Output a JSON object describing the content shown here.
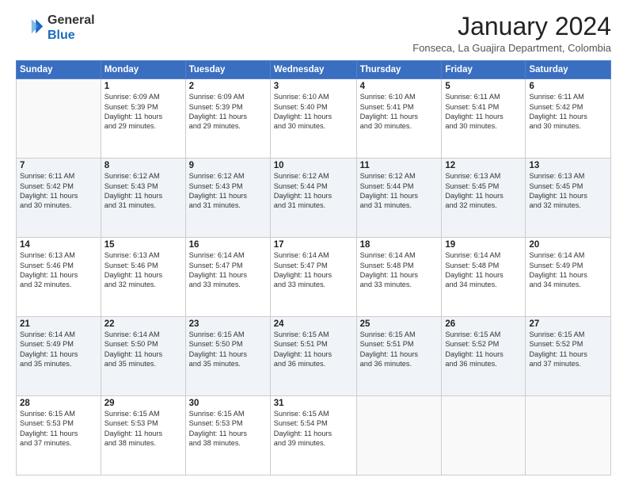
{
  "header": {
    "logo_line1": "General",
    "logo_line2": "Blue",
    "month_title": "January 2024",
    "subtitle": "Fonseca, La Guajira Department, Colombia"
  },
  "weekdays": [
    "Sunday",
    "Monday",
    "Tuesday",
    "Wednesday",
    "Thursday",
    "Friday",
    "Saturday"
  ],
  "weeks": [
    [
      {
        "day": "",
        "info": ""
      },
      {
        "day": "1",
        "info": "Sunrise: 6:09 AM\nSunset: 5:39 PM\nDaylight: 11 hours\nand 29 minutes."
      },
      {
        "day": "2",
        "info": "Sunrise: 6:09 AM\nSunset: 5:39 PM\nDaylight: 11 hours\nand 29 minutes."
      },
      {
        "day": "3",
        "info": "Sunrise: 6:10 AM\nSunset: 5:40 PM\nDaylight: 11 hours\nand 30 minutes."
      },
      {
        "day": "4",
        "info": "Sunrise: 6:10 AM\nSunset: 5:41 PM\nDaylight: 11 hours\nand 30 minutes."
      },
      {
        "day": "5",
        "info": "Sunrise: 6:11 AM\nSunset: 5:41 PM\nDaylight: 11 hours\nand 30 minutes."
      },
      {
        "day": "6",
        "info": "Sunrise: 6:11 AM\nSunset: 5:42 PM\nDaylight: 11 hours\nand 30 minutes."
      }
    ],
    [
      {
        "day": "7",
        "info": ""
      },
      {
        "day": "8",
        "info": "Sunrise: 6:12 AM\nSunset: 5:43 PM\nDaylight: 11 hours\nand 31 minutes."
      },
      {
        "day": "9",
        "info": "Sunrise: 6:12 AM\nSunset: 5:43 PM\nDaylight: 11 hours\nand 31 minutes."
      },
      {
        "day": "10",
        "info": "Sunrise: 6:12 AM\nSunset: 5:44 PM\nDaylight: 11 hours\nand 31 minutes."
      },
      {
        "day": "11",
        "info": "Sunrise: 6:12 AM\nSunset: 5:44 PM\nDaylight: 11 hours\nand 31 minutes."
      },
      {
        "day": "12",
        "info": "Sunrise: 6:13 AM\nSunset: 5:45 PM\nDaylight: 11 hours\nand 32 minutes."
      },
      {
        "day": "13",
        "info": "Sunrise: 6:13 AM\nSunset: 5:45 PM\nDaylight: 11 hours\nand 32 minutes."
      }
    ],
    [
      {
        "day": "14",
        "info": ""
      },
      {
        "day": "15",
        "info": "Sunrise: 6:13 AM\nSunset: 5:46 PM\nDaylight: 11 hours\nand 32 minutes."
      },
      {
        "day": "16",
        "info": "Sunrise: 6:14 AM\nSunset: 5:47 PM\nDaylight: 11 hours\nand 33 minutes."
      },
      {
        "day": "17",
        "info": "Sunrise: 6:14 AM\nSunset: 5:47 PM\nDaylight: 11 hours\nand 33 minutes."
      },
      {
        "day": "18",
        "info": "Sunrise: 6:14 AM\nSunset: 5:48 PM\nDaylight: 11 hours\nand 33 minutes."
      },
      {
        "day": "19",
        "info": "Sunrise: 6:14 AM\nSunset: 5:48 PM\nDaylight: 11 hours\nand 34 minutes."
      },
      {
        "day": "20",
        "info": "Sunrise: 6:14 AM\nSunset: 5:49 PM\nDaylight: 11 hours\nand 34 minutes."
      }
    ],
    [
      {
        "day": "21",
        "info": ""
      },
      {
        "day": "22",
        "info": "Sunrise: 6:14 AM\nSunset: 5:50 PM\nDaylight: 11 hours\nand 35 minutes."
      },
      {
        "day": "23",
        "info": "Sunrise: 6:15 AM\nSunset: 5:50 PM\nDaylight: 11 hours\nand 35 minutes."
      },
      {
        "day": "24",
        "info": "Sunrise: 6:15 AM\nSunset: 5:51 PM\nDaylight: 11 hours\nand 36 minutes."
      },
      {
        "day": "25",
        "info": "Sunrise: 6:15 AM\nSunset: 5:51 PM\nDaylight: 11 hours\nand 36 minutes."
      },
      {
        "day": "26",
        "info": "Sunrise: 6:15 AM\nSunset: 5:52 PM\nDaylight: 11 hours\nand 36 minutes."
      },
      {
        "day": "27",
        "info": "Sunrise: 6:15 AM\nSunset: 5:52 PM\nDaylight: 11 hours\nand 37 minutes."
      }
    ],
    [
      {
        "day": "28",
        "info": "Sunrise: 6:15 AM\nSunset: 5:53 PM\nDaylight: 11 hours\nand 37 minutes."
      },
      {
        "day": "29",
        "info": "Sunrise: 6:15 AM\nSunset: 5:53 PM\nDaylight: 11 hours\nand 38 minutes."
      },
      {
        "day": "30",
        "info": "Sunrise: 6:15 AM\nSunset: 5:53 PM\nDaylight: 11 hours\nand 38 minutes."
      },
      {
        "day": "31",
        "info": "Sunrise: 6:15 AM\nSunset: 5:54 PM\nDaylight: 11 hours\nand 39 minutes."
      },
      {
        "day": "",
        "info": ""
      },
      {
        "day": "",
        "info": ""
      },
      {
        "day": "",
        "info": ""
      }
    ]
  ],
  "week7_sunday": {
    "day": "7",
    "info": "Sunrise: 6:11 AM\nSunset: 5:42 PM\nDaylight: 11 hours\nand 30 minutes."
  },
  "week14_sunday": {
    "day": "14",
    "info": "Sunrise: 6:13 AM\nSunset: 5:46 PM\nDaylight: 11 hours\nand 32 minutes."
  },
  "week21_sunday": {
    "day": "21",
    "info": "Sunrise: 6:14 AM\nSunset: 5:49 PM\nDaylight: 11 hours\nand 35 minutes."
  }
}
